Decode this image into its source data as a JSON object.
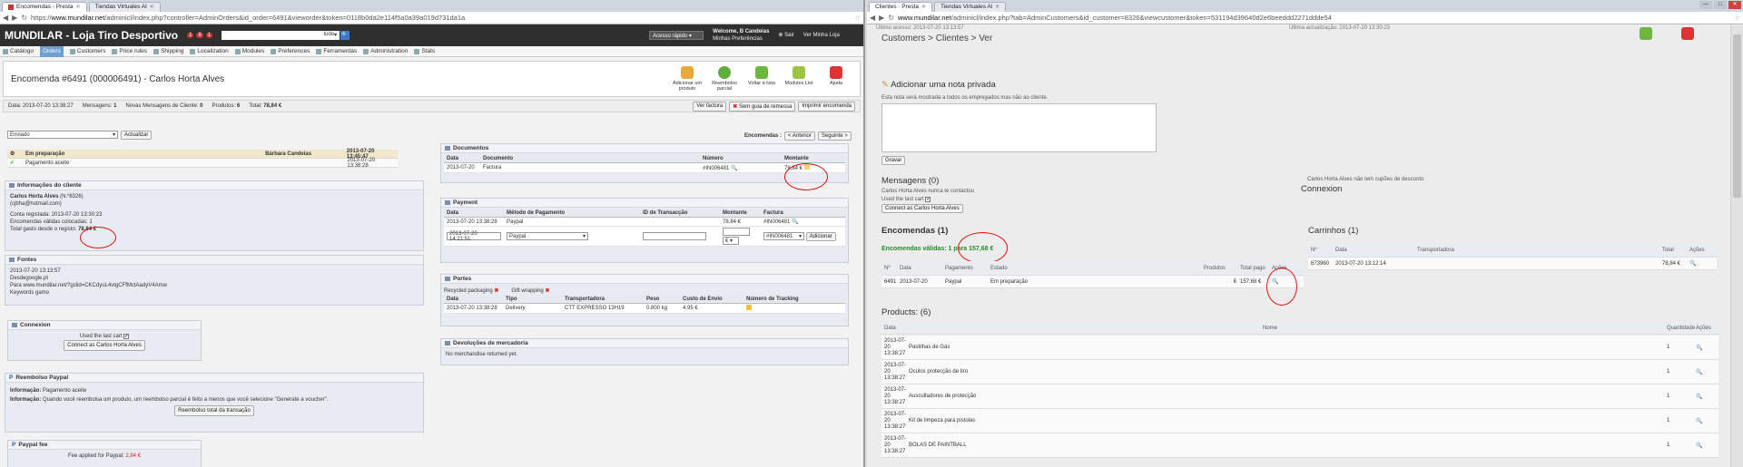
{
  "left": {
    "tabs": [
      {
        "label": "Encomendas - Presta",
        "active": true
      },
      {
        "label": "Tiendas Virtuales Al",
        "active": false
      }
    ],
    "url_prefix": "https://",
    "url_domain": "www.mundilar.net",
    "url_rest": "/adminicl/index.php?controller=AdminOrders&id_order=6491&vieworder&token=0118b0da2e114f5a0a39a019d731da1a",
    "header": {
      "brand": "MUNDILAR - Loja Tiro Desportivo",
      "badges": [
        "1",
        "8",
        "1"
      ],
      "search_scope": "tudo",
      "quick_access": "Acesso rápido",
      "welcome": "Welcome, B Candeias",
      "preferences": "Minhas Preferências",
      "logout": "Sair",
      "view_shop": "Ver Minha Loja"
    },
    "menu": [
      "Catálogo",
      "Orders",
      "Customers",
      "Price rules",
      "Shipping",
      "Localization",
      "Modules",
      "Preferences",
      "Ferramentas",
      "Administration",
      "Stats"
    ],
    "order_title": "Encomenda #6491 (000006491) - Carlos Horta Alves",
    "toolbar": [
      "Adicionar um produto",
      "Reembolso parcial",
      "Voltar à lista",
      "Modules List",
      "Ajuda"
    ],
    "summary": {
      "date_label": "Data:",
      "date": "2013-07-20 13:38:27",
      "messages_label": "Mensagens:",
      "messages": "1",
      "new_msgs_label": "Novas Mensagens de Cliente:",
      "new_msgs": "0",
      "products_label": "Produtos:",
      "products": "6",
      "total_label": "Total:",
      "total": "78,84 €",
      "view_invoice": "Ver factura",
      "no_delivery": "Sem guia de remessa",
      "print": "Imprimir encomenda"
    },
    "status_select": "Enviado",
    "update_btn": "Actualizar",
    "encomendas_label": "Encomendas :",
    "prev_btn": "< Anterior",
    "next_btn": "Seguinte >",
    "history": [
      {
        "status": "Em preparação",
        "employee": "Bárbara Candeias",
        "date": "2013-07-20 13:45:47"
      },
      {
        "status": "Pagamento aceite",
        "employee": "",
        "date": "2013-07-20 13:38:28"
      }
    ],
    "client": {
      "title": "Informações do cliente",
      "name": "Carlos Horta Alves",
      "id": "(N.º8326)",
      "email": "(cjbha@hotmail.com)",
      "registered_label": "Conta registada:",
      "registered": "2013-07-20 13:30:23",
      "valid_orders_label": "Encomendas válidas colocadas:",
      "valid_orders": "1",
      "total_spent_label": "Total gasto desde o registo:",
      "total_spent": "78,84 €"
    },
    "sources": {
      "title": "Fontes",
      "date": "2013-07-20 13:13:57",
      "from": "Desdegoogle.pt",
      "to": "Para www.mundilar.net/?gclid=CKCdyuL4vtgCFfMctAadyV4Amw",
      "keywords": "Keywords gamo"
    },
    "connexion": {
      "title": "Connexion",
      "used_last_cart": "Used the last cart",
      "button": "Connect as Carlos Horta Alves"
    },
    "paypal_refund": {
      "title": "Reembolso Paypal",
      "info_label": "Informação:",
      "info1": "Pagamento aceite",
      "info2": "Quando você reembolsa um produto, um reembolso parcial é feito a menos que você selecione \"Generate a voucher\".",
      "button": "Reembolso total da transação"
    },
    "paypal_fee": {
      "title": "Paypal fee",
      "text": "Fee applied for Paypal:",
      "value": "2,84 €"
    },
    "documents": {
      "title": "Documentos",
      "headers": [
        "Data",
        "Documento",
        "Número",
        "Montante"
      ],
      "rows": [
        [
          "2013-07-20",
          "Factura",
          "#IN006481",
          "78,84 €"
        ]
      ]
    },
    "payment": {
      "title": "Payment",
      "headers": [
        "Data",
        "Método de Pagamento",
        "ID de Transacção",
        "Montante",
        "Factura"
      ],
      "rows": [
        [
          "2013-07-20 13:38:28",
          "Paypal",
          "",
          "78,84 €",
          "#IN006481"
        ]
      ],
      "new_date": "2013-07-20 14:21:51",
      "new_method": "Paypal",
      "new_invoice": "#IN006481",
      "add_btn": "Adicionar"
    },
    "portes": {
      "title": "Portes",
      "recycled": "Recycled packaging",
      "gift": "Gift wrapping",
      "headers": [
        "Data",
        "Tipo",
        "Transportadora",
        "Peso",
        "Custo de Envio",
        "Número de Tracking"
      ],
      "rows": [
        [
          "2013-07-20 13:38:28",
          "Delivery",
          "CTT EXPRESSO 13H19",
          "0.800 kg",
          "4.95 €",
          ""
        ]
      ]
    },
    "returns": {
      "title": "Devoluções de mercadoria",
      "text": "No merchandise returned yet."
    }
  },
  "right": {
    "tabs": [
      {
        "label": "Clientes · Presta",
        "active": true
      },
      {
        "label": "Tiendas Virtuales Al",
        "active": false
      }
    ],
    "url_domain": "www.mundilar.net",
    "url_rest": "/adminicl/index.php?tab=AdminCustomers&id_customer=8326&viewcustomer&token=531194d39640d2e6beeddd2271ddde54",
    "breadcrumb": [
      "Customers",
      "Clientes",
      "Ver"
    ],
    "top_left": "Último acesso: 2013-07-20 13:13:57",
    "top_right": "Última actualização: 2013-07-20 13:30:23",
    "note_title": "Adicionar uma nota privada",
    "note_hint": "Esta nota será mostrada a todos os empregados mas não ao cliente.",
    "note_btn": "Gravar",
    "messages_title": "Mensagens (0)",
    "messages_sub": "Carlos Horta Alves nunca te contactou",
    "last_cart": "Used the last cart",
    "connect_btn": "Connect as Carlos Horta Alves",
    "vouchers_text": "Carlos Horta Alves não tem cupões de desconto",
    "connexion_title": "Connexion",
    "orders_title": "Encomendas (1)",
    "valid_orders": "Encomendas válidas: 1 para 157,68 €",
    "orders_headers": [
      "Nº",
      "Data",
      "Pagamento",
      "Estado",
      "Produtos",
      "Total pago",
      "Ações"
    ],
    "orders_rows": [
      [
        "6491",
        "2013-07-20",
        "Paypal",
        "Em preparação",
        "6",
        "157,68 €"
      ]
    ],
    "carts_title": "Carrinhos (1)",
    "carts_headers": [
      "Nº",
      "Data",
      "Transportadora",
      "Total",
      "Ações"
    ],
    "carts_rows": [
      [
        "673960",
        "2013-07-20 13:12:14",
        "",
        "78,84 €"
      ]
    ],
    "products_title": "Products: (6)",
    "products_headers": [
      "Data",
      "Nome",
      "Quantidade",
      "Ações"
    ],
    "products_rows": [
      [
        "2013-07-20 13:38:27",
        "Pastilhas de Gás",
        "1"
      ],
      [
        "2013-07-20 13:38:27",
        "Oculos protecção de tiro",
        "1"
      ],
      [
        "2013-07-20 13:38:27",
        "Auscultadores de protecção",
        "1"
      ],
      [
        "2013-07-20 13:38:27",
        "Kit de limpeza para pistolas",
        "1"
      ],
      [
        "2013-07-20 13:38:27",
        "BOLAS DE PAINTBALL",
        "1"
      ]
    ]
  }
}
